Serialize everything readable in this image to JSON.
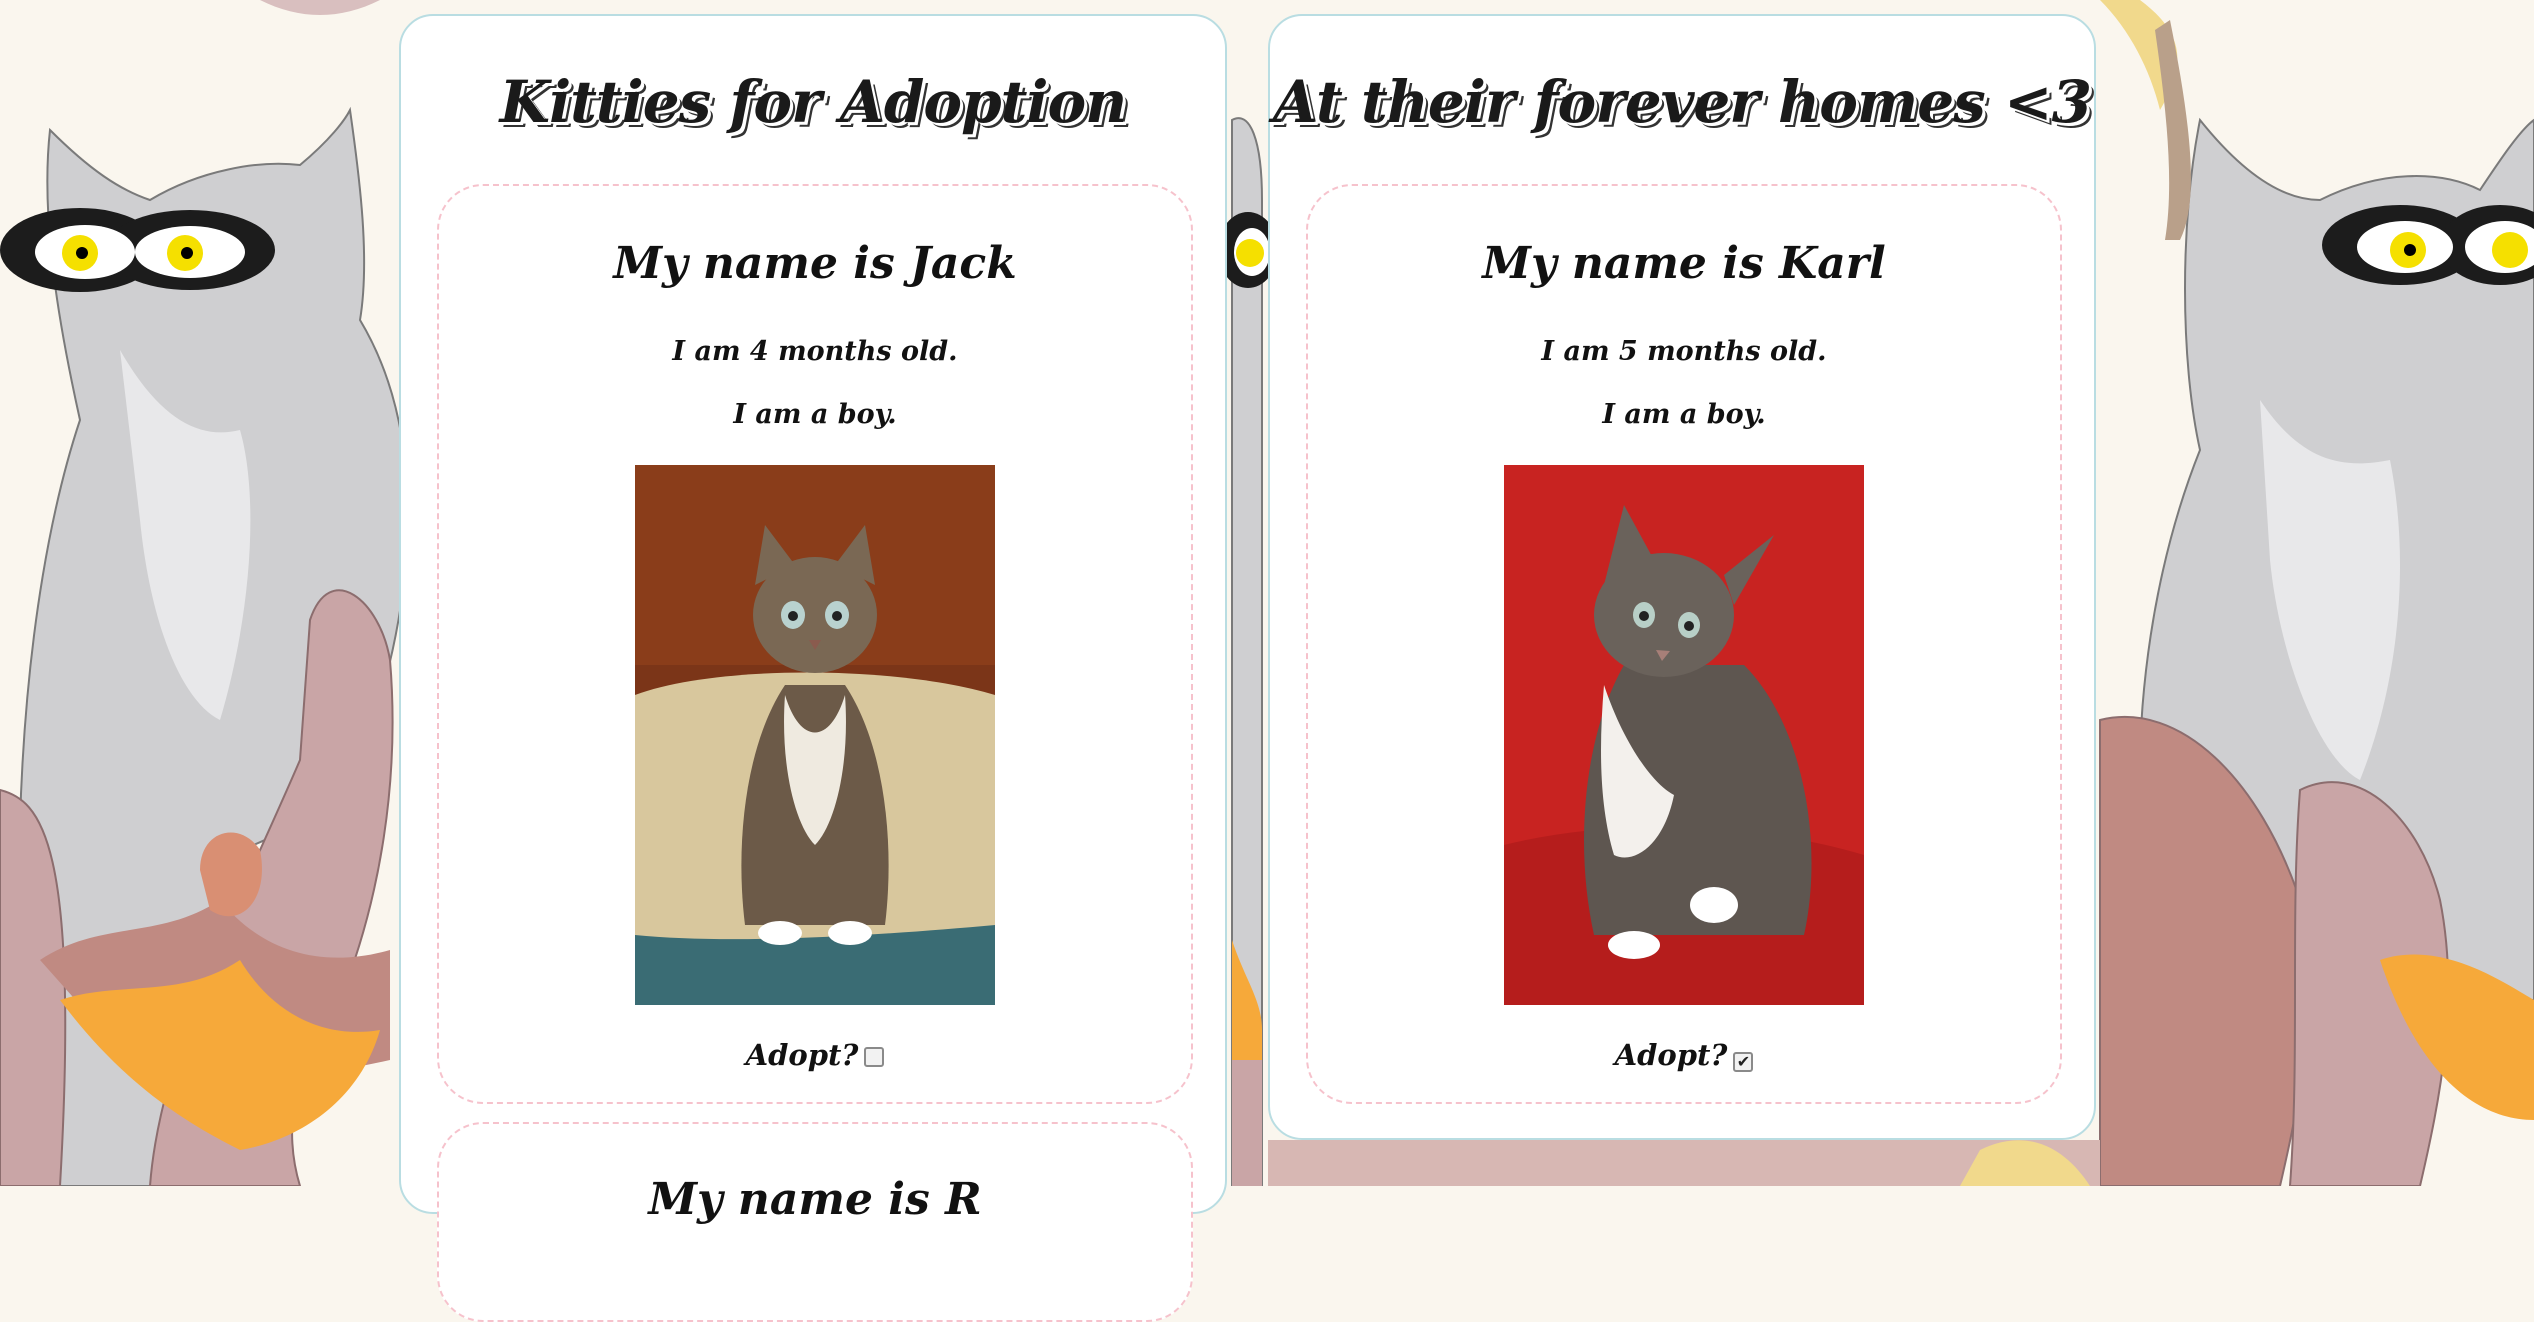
{
  "adoption_panel": {
    "title": "Kitties for Adoption",
    "cards": [
      {
        "name": "My name is Jack",
        "age": "I am 4 months old.",
        "gender": "I am a boy.",
        "adopt_label": "Adopt?",
        "adopt_checked": false
      }
    ],
    "next_card_name_partial": "My name is R"
  },
  "homes_panel": {
    "title": "At their forever homes <3",
    "cards": [
      {
        "name": "My name is Karl",
        "age": "I am 5 months old.",
        "gender": "I am a boy.",
        "adopt_label": "Adopt?",
        "adopt_checked": true
      }
    ]
  },
  "icons": {
    "checkmark": "✔"
  },
  "colors": {
    "panel_border": "#b9dde2",
    "card_border": "#f6c2cc",
    "wallpaper": "#faf6ee"
  }
}
